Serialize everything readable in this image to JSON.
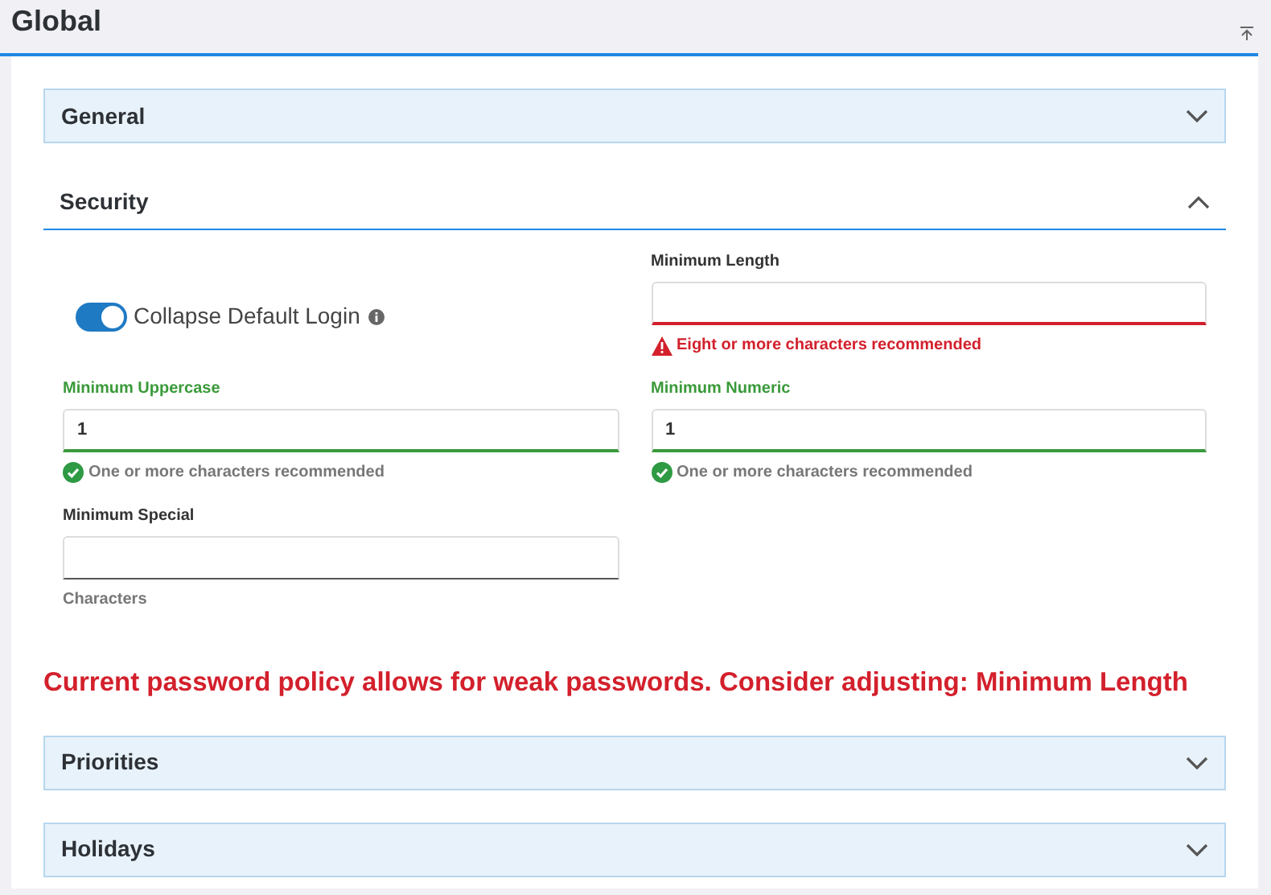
{
  "page": {
    "title": "Global"
  },
  "sections": [
    {
      "title": "General",
      "expanded": false
    },
    {
      "title": "Security",
      "expanded": true,
      "items": [
        {
          "kind": "toggle",
          "label": "Collapse Default Login",
          "on": true
        },
        {
          "kind": "number",
          "label": "Minimum Length",
          "value": "",
          "invalid": true,
          "hint": "Eight or more characters recommended"
        },
        {
          "kind": "number",
          "label": "Minimum Uppercase",
          "value": "1",
          "invalid": false,
          "valid": true,
          "hint": "One or more characters recommended"
        },
        {
          "kind": "number",
          "label": "Minimum Numeric",
          "value": "1",
          "invalid": false,
          "valid": true,
          "hint": "One or more characters recommended"
        },
        {
          "kind": "number",
          "label": "Minimum Special",
          "value": "",
          "invalid": false,
          "valid": false,
          "hint": "Characters"
        }
      ],
      "warning": "Current password policy allows for weak passwords. Consider adjusting: Minimum Length"
    },
    {
      "title": "Priorities",
      "expanded": false
    },
    {
      "title": "Holidays",
      "expanded": false
    }
  ]
}
